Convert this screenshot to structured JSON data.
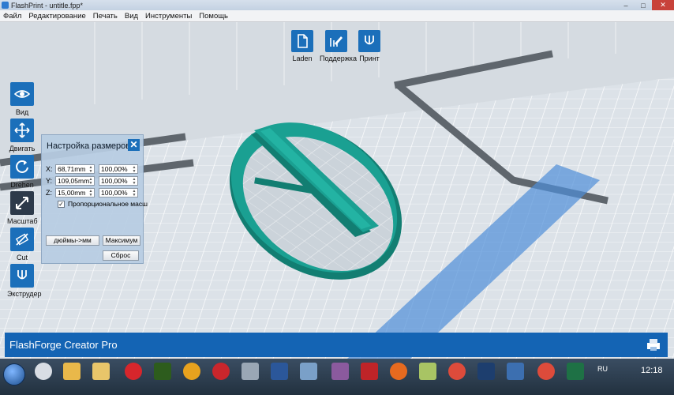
{
  "window": {
    "title": "FlashPrint - untitle.fpp*"
  },
  "menu": {
    "items": [
      "Файл",
      "Редактирование",
      "Печать",
      "Вид",
      "Инструменты",
      "Помощь"
    ]
  },
  "top_toolbar": [
    {
      "label": "Laden",
      "icon": "file-icon"
    },
    {
      "label": "Поддержка",
      "icon": "support-edit-icon"
    },
    {
      "label": "Принт",
      "icon": "print-icon"
    }
  ],
  "left_toolbar": [
    {
      "label": "Вид",
      "icon": "eye-icon"
    },
    {
      "label": "Двигать",
      "icon": "move-icon"
    },
    {
      "label": "Drehen",
      "icon": "rotate-icon"
    },
    {
      "label": "Масштаб",
      "icon": "scale-icon"
    },
    {
      "label": "Cut",
      "icon": "cut-icon"
    },
    {
      "label": "Экструдер",
      "icon": "extruder-icon"
    }
  ],
  "scale_panel": {
    "title": "Настройка размеров",
    "rows": [
      {
        "axis": "X:",
        "size": "68,71mm",
        "percent": "100,00%"
      },
      {
        "axis": "Y:",
        "size": "109,05mm",
        "percent": "100,00%"
      },
      {
        "axis": "Z:",
        "size": "15,00mm",
        "percent": "100,00%"
      }
    ],
    "uniform_checkbox": {
      "label": "Пропорциональное масш",
      "checked": true
    },
    "inch_button": "дюймы->мм",
    "max_button": "Максимум",
    "reset_button": "Сброс"
  },
  "status": {
    "printer": "FlashForge Creator Pro"
  },
  "colors": {
    "accent": "#1b6fba",
    "model": "#1a9a8c",
    "status_bar": "#1464b4"
  },
  "taskbar": {
    "apps": [
      "explorer-icon",
      "paint-icon",
      "folder-icon",
      "opera-icon",
      "dreamweaver-icon",
      "archicad-icon",
      "cinema4d-icon",
      "calculator-icon",
      "word-icon",
      "sketchup-icon",
      "winamp-icon",
      "filezilla-icon",
      "firefox-icon",
      "notepad-icon",
      "chrome-icon",
      "photoshop-icon",
      "flashprint-icon",
      "chrome-icon",
      "excel-icon"
    ],
    "lang": "RU",
    "clock": "12:18"
  }
}
